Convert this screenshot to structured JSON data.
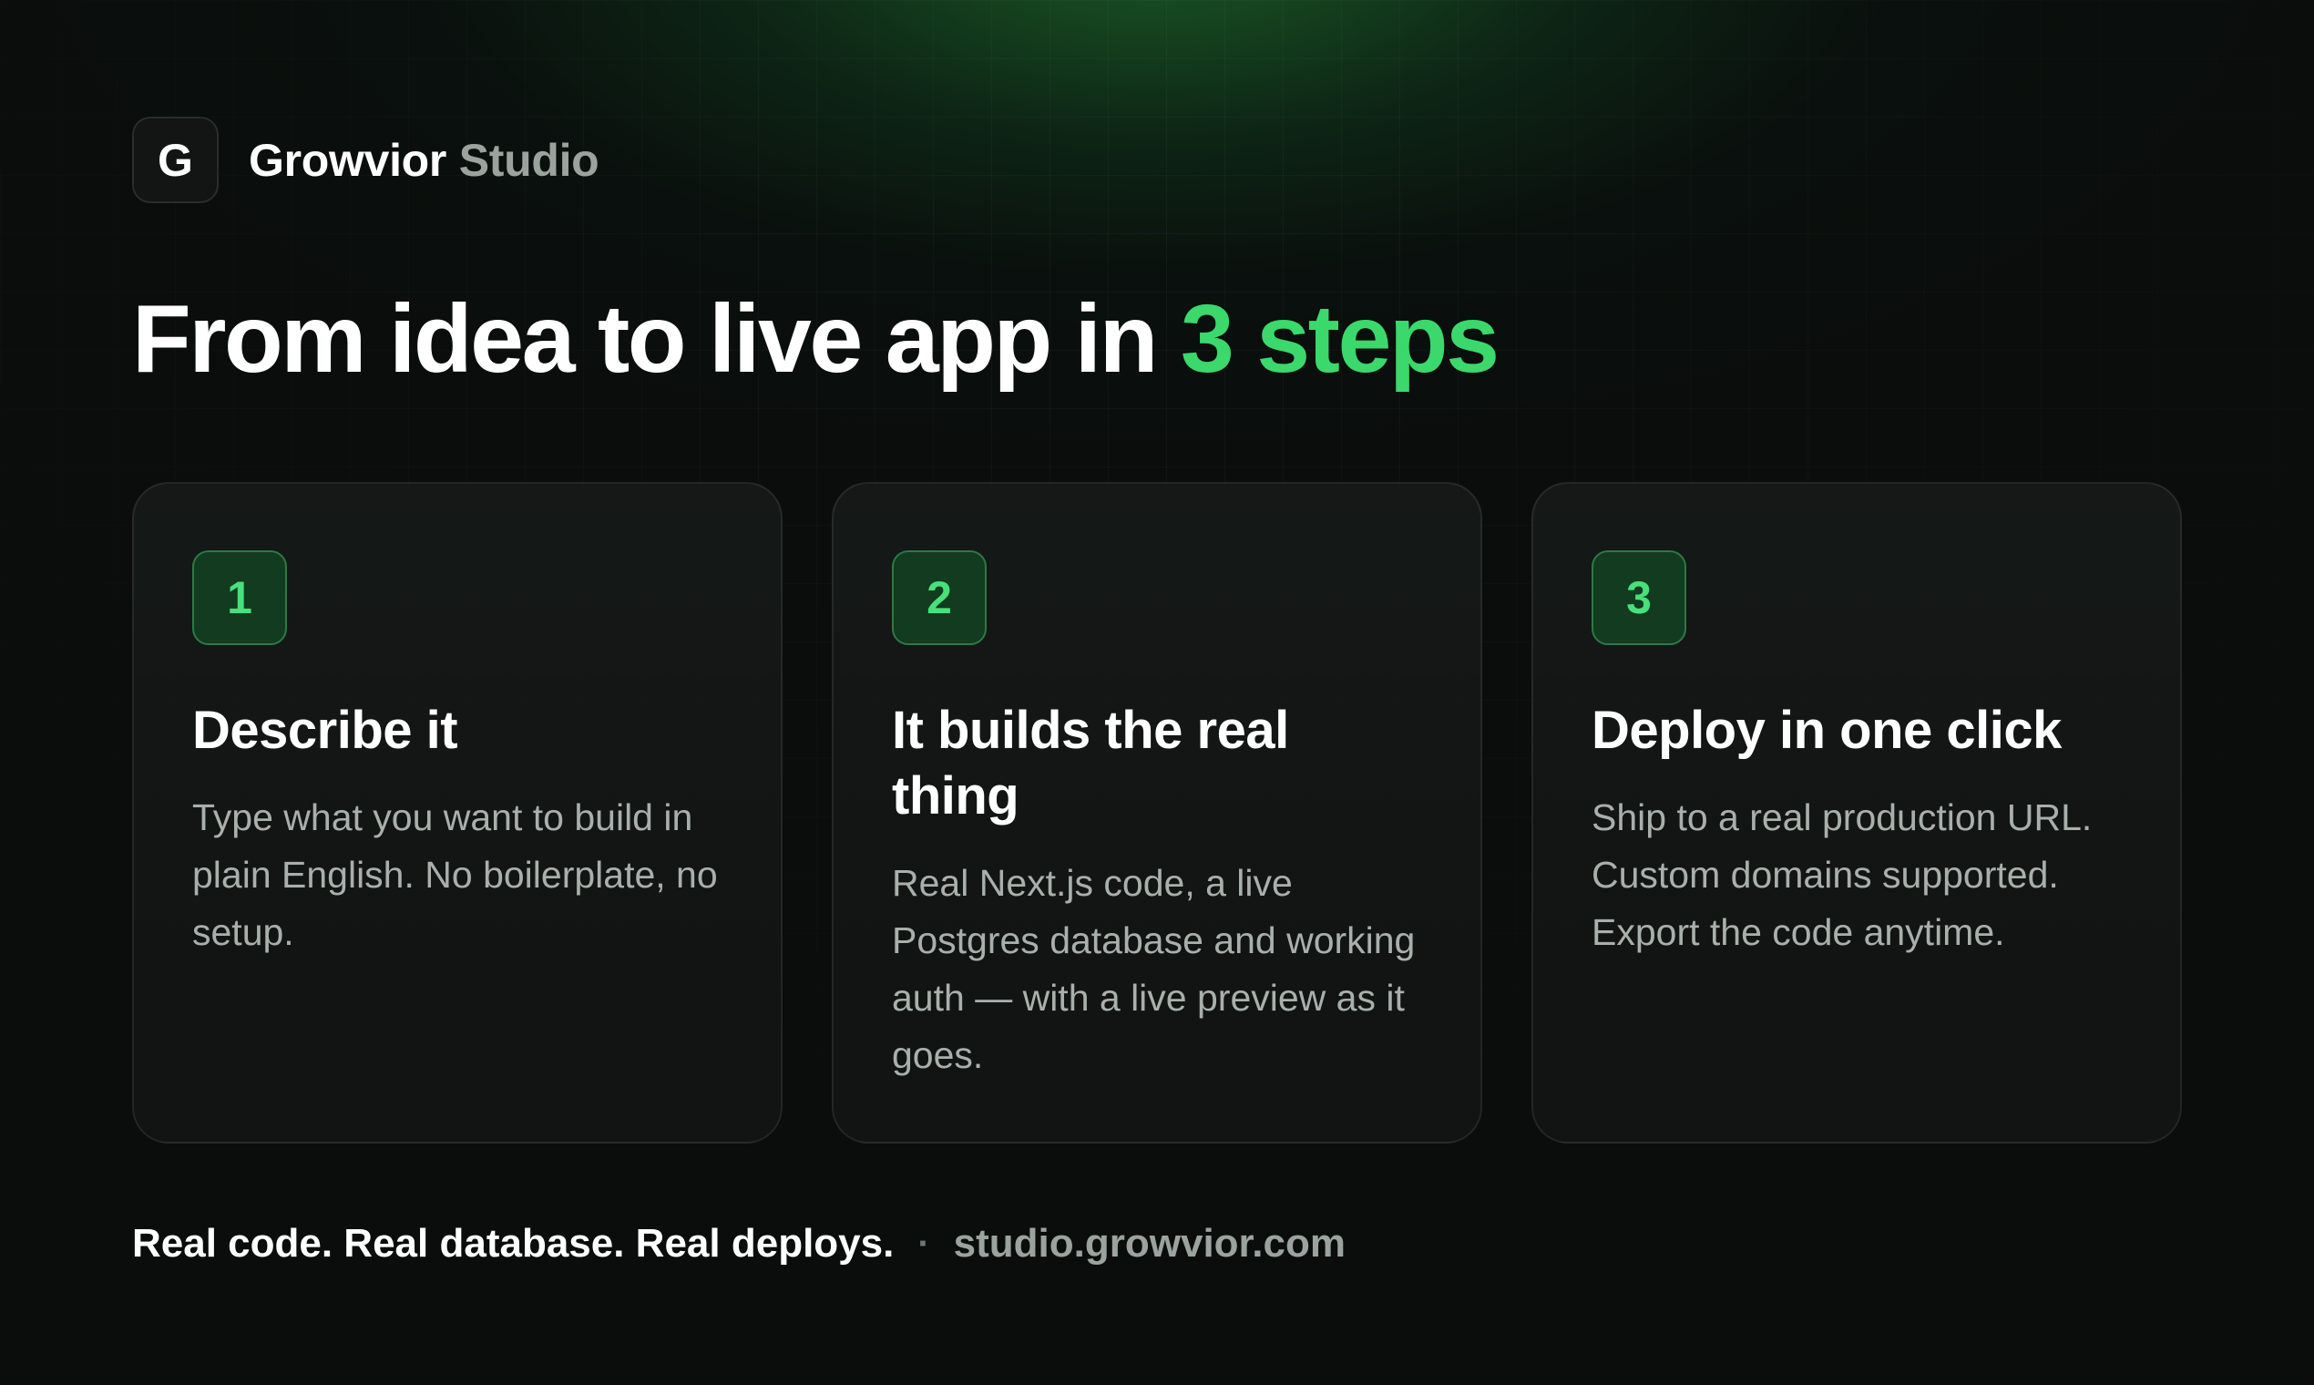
{
  "brand": {
    "logo_letter": "G",
    "name": "Growvior",
    "suffix": "Studio"
  },
  "headline": {
    "prefix": "From idea to live app in",
    "accent": "3 steps"
  },
  "steps": [
    {
      "number": "1",
      "title": "Describe it",
      "body": "Type what you want to build in plain English. No boilerplate, no setup."
    },
    {
      "number": "2",
      "title": "It builds the real thing",
      "body": "Real Next.js code, a live Postgres database and working auth — with a live preview as it goes."
    },
    {
      "number": "3",
      "title": "Deploy in one click",
      "body": "Ship to a real production URL. Custom domains supported. Export the code anytime."
    }
  ],
  "footer": {
    "tagline": "Real code. Real database. Real deploys.",
    "separator": "·",
    "url": "studio.growvior.com"
  },
  "colors": {
    "accent": "#3bd86b",
    "background": "#0a0d0c",
    "badge_bg": "#123b20",
    "badge_border": "#2c7a44",
    "muted_text": "#a9b0ac"
  }
}
